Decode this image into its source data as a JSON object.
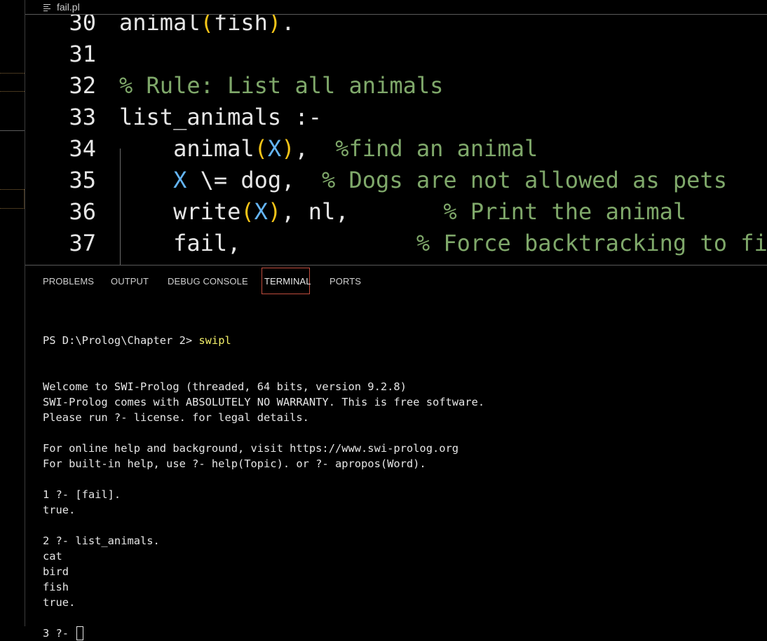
{
  "editor": {
    "filename": "fail.pl",
    "lines": [
      {
        "number": "30",
        "tokens": [
          {
            "text": "animal",
            "style": "default"
          },
          {
            "text": "(",
            "style": "paren"
          },
          {
            "text": "fish",
            "style": "default"
          },
          {
            "text": ")",
            "style": "paren"
          },
          {
            "text": ".",
            "style": "default"
          }
        ]
      },
      {
        "number": "31",
        "tokens": []
      },
      {
        "number": "32",
        "tokens": [
          {
            "text": "% Rule: List all animals",
            "style": "comment"
          }
        ]
      },
      {
        "number": "33",
        "tokens": [
          {
            "text": "list_animals :-",
            "style": "default"
          }
        ]
      },
      {
        "number": "34",
        "tokens": [
          {
            "text": "    animal",
            "style": "default"
          },
          {
            "text": "(",
            "style": "paren"
          },
          {
            "text": "X",
            "style": "var"
          },
          {
            "text": ")",
            "style": "paren"
          },
          {
            "text": ",  ",
            "style": "default"
          },
          {
            "text": "%find an animal",
            "style": "comment"
          }
        ]
      },
      {
        "number": "35",
        "tokens": [
          {
            "text": "    ",
            "style": "default"
          },
          {
            "text": "X",
            "style": "var"
          },
          {
            "text": " \\= dog,  ",
            "style": "default"
          },
          {
            "text": "% Dogs are not allowed as pets",
            "style": "comment"
          }
        ]
      },
      {
        "number": "36",
        "tokens": [
          {
            "text": "    write",
            "style": "default"
          },
          {
            "text": "(",
            "style": "paren"
          },
          {
            "text": "X",
            "style": "var"
          },
          {
            "text": ")",
            "style": "paren"
          },
          {
            "text": ", nl,       ",
            "style": "default"
          },
          {
            "text": "% Print the animal",
            "style": "comment"
          }
        ]
      },
      {
        "number": "37",
        "tokens": [
          {
            "text": "    fail,             ",
            "style": "default"
          },
          {
            "text": "% Force backtracking to fi",
            "style": "comment"
          }
        ]
      }
    ]
  },
  "panel": {
    "tabs": [
      "PROBLEMS",
      "OUTPUT",
      "DEBUG CONSOLE",
      "TERMINAL",
      "PORTS"
    ],
    "active_tab": "TERMINAL"
  },
  "terminal": {
    "prompt": "PS D:\\Prolog\\Chapter 2> ",
    "command": "swipl",
    "lines": [
      "Welcome to SWI-Prolog (threaded, 64 bits, version 9.2.8)",
      "SWI-Prolog comes with ABSOLUTELY NO WARRANTY. This is free software.",
      "Please run ?- license. for legal details.",
      "",
      "For online help and background, visit https://www.swi-prolog.org",
      "For built-in help, use ?- help(Topic). or ?- apropos(Word).",
      "",
      "1 ?- [fail].",
      "true.",
      "",
      "2 ?- list_animals.",
      "cat",
      "bird",
      "fish",
      "true.",
      ""
    ],
    "current_prompt": "3 ?- "
  },
  "colors": {
    "comment": "#7fa86a",
    "paren": "#f5c518",
    "variable": "#64b5f6",
    "command": "#f4f06a",
    "active_tab_border": "#c04d3e"
  }
}
